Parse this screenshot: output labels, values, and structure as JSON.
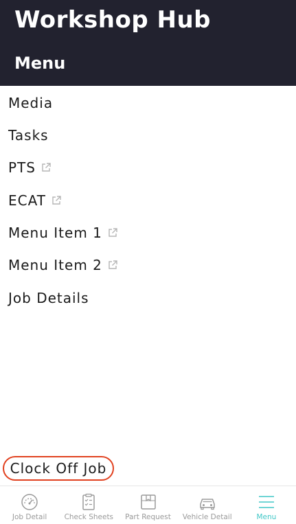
{
  "header": {
    "app_title": "Workshop Hub",
    "page_title": "Menu"
  },
  "menu": {
    "items": [
      {
        "label": "Media",
        "external": false
      },
      {
        "label": "Tasks",
        "external": false
      },
      {
        "label": "PTS",
        "external": true
      },
      {
        "label": "ECAT",
        "external": true
      },
      {
        "label": "Menu Item 1",
        "external": true
      },
      {
        "label": "Menu Item 2",
        "external": true
      },
      {
        "label": "Job Details",
        "external": false
      }
    ],
    "external_icon": "external-link-icon"
  },
  "clock_off": {
    "label": "Clock Off Job",
    "outline_color": "#e1401e"
  },
  "tabbar": {
    "tabs": [
      {
        "label": "Job Detail",
        "icon": "gauge-icon"
      },
      {
        "label": "Check Sheets",
        "icon": "clipboard-check-icon"
      },
      {
        "label": "Part Request",
        "icon": "box-icon"
      },
      {
        "label": "Vehicle Detail",
        "icon": "car-icon"
      },
      {
        "label": "Menu",
        "icon": "hamburger-menu-icon"
      }
    ],
    "active": "Menu",
    "active_color": "#40c7c7",
    "inactive_color": "#9a9a9a"
  },
  "colors": {
    "header_bg": "#22222f",
    "header_text": "#ffffff"
  }
}
